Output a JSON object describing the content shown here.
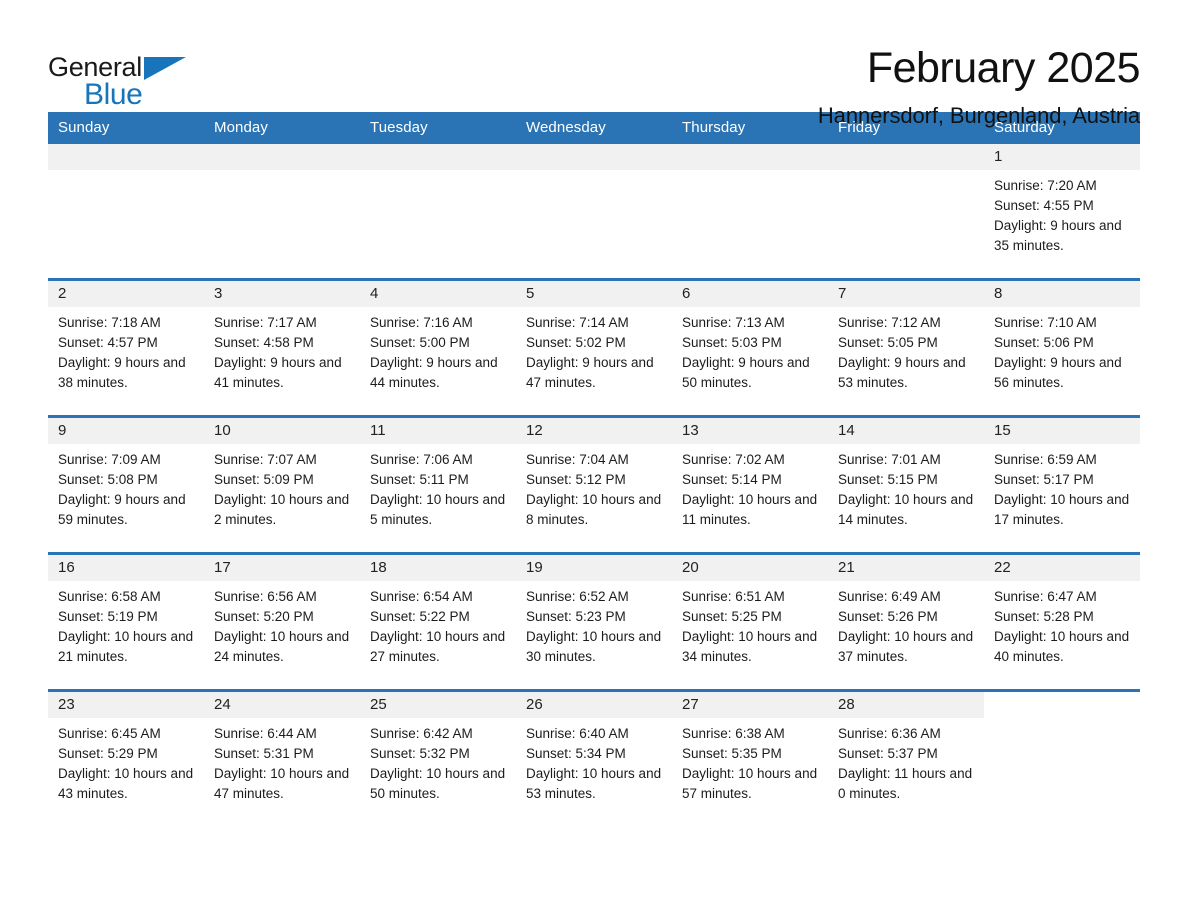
{
  "brand": {
    "name_part1": "General",
    "name_part2": "Blue",
    "triangle_color": "#1874bb"
  },
  "header": {
    "title": "February 2025",
    "subtitle": "Hannersdorf, Burgenland, Austria",
    "accent_color": "#2a74b5"
  },
  "weekday_headers": [
    "Sunday",
    "Monday",
    "Tuesday",
    "Wednesday",
    "Thursday",
    "Friday",
    "Saturday"
  ],
  "weeks": [
    [
      {
        "day": "",
        "sunrise": "",
        "sunset": "",
        "daylight": "",
        "empty": true
      },
      {
        "day": "",
        "sunrise": "",
        "sunset": "",
        "daylight": "",
        "empty": true
      },
      {
        "day": "",
        "sunrise": "",
        "sunset": "",
        "daylight": "",
        "empty": true
      },
      {
        "day": "",
        "sunrise": "",
        "sunset": "",
        "daylight": "",
        "empty": true
      },
      {
        "day": "",
        "sunrise": "",
        "sunset": "",
        "daylight": "",
        "empty": true
      },
      {
        "day": "",
        "sunrise": "",
        "sunset": "",
        "daylight": "",
        "empty": true
      },
      {
        "day": "1",
        "sunrise": "Sunrise: 7:20 AM",
        "sunset": "Sunset: 4:55 PM",
        "daylight": "Daylight: 9 hours and 35 minutes.",
        "empty": false
      }
    ],
    [
      {
        "day": "2",
        "sunrise": "Sunrise: 7:18 AM",
        "sunset": "Sunset: 4:57 PM",
        "daylight": "Daylight: 9 hours and 38 minutes.",
        "empty": false
      },
      {
        "day": "3",
        "sunrise": "Sunrise: 7:17 AM",
        "sunset": "Sunset: 4:58 PM",
        "daylight": "Daylight: 9 hours and 41 minutes.",
        "empty": false
      },
      {
        "day": "4",
        "sunrise": "Sunrise: 7:16 AM",
        "sunset": "Sunset: 5:00 PM",
        "daylight": "Daylight: 9 hours and 44 minutes.",
        "empty": false
      },
      {
        "day": "5",
        "sunrise": "Sunrise: 7:14 AM",
        "sunset": "Sunset: 5:02 PM",
        "daylight": "Daylight: 9 hours and 47 minutes.",
        "empty": false
      },
      {
        "day": "6",
        "sunrise": "Sunrise: 7:13 AM",
        "sunset": "Sunset: 5:03 PM",
        "daylight": "Daylight: 9 hours and 50 minutes.",
        "empty": false
      },
      {
        "day": "7",
        "sunrise": "Sunrise: 7:12 AM",
        "sunset": "Sunset: 5:05 PM",
        "daylight": "Daylight: 9 hours and 53 minutes.",
        "empty": false
      },
      {
        "day": "8",
        "sunrise": "Sunrise: 7:10 AM",
        "sunset": "Sunset: 5:06 PM",
        "daylight": "Daylight: 9 hours and 56 minutes.",
        "empty": false
      }
    ],
    [
      {
        "day": "9",
        "sunrise": "Sunrise: 7:09 AM",
        "sunset": "Sunset: 5:08 PM",
        "daylight": "Daylight: 9 hours and 59 minutes.",
        "empty": false
      },
      {
        "day": "10",
        "sunrise": "Sunrise: 7:07 AM",
        "sunset": "Sunset: 5:09 PM",
        "daylight": "Daylight: 10 hours and 2 minutes.",
        "empty": false
      },
      {
        "day": "11",
        "sunrise": "Sunrise: 7:06 AM",
        "sunset": "Sunset: 5:11 PM",
        "daylight": "Daylight: 10 hours and 5 minutes.",
        "empty": false
      },
      {
        "day": "12",
        "sunrise": "Sunrise: 7:04 AM",
        "sunset": "Sunset: 5:12 PM",
        "daylight": "Daylight: 10 hours and 8 minutes.",
        "empty": false
      },
      {
        "day": "13",
        "sunrise": "Sunrise: 7:02 AM",
        "sunset": "Sunset: 5:14 PM",
        "daylight": "Daylight: 10 hours and 11 minutes.",
        "empty": false
      },
      {
        "day": "14",
        "sunrise": "Sunrise: 7:01 AM",
        "sunset": "Sunset: 5:15 PM",
        "daylight": "Daylight: 10 hours and 14 minutes.",
        "empty": false
      },
      {
        "day": "15",
        "sunrise": "Sunrise: 6:59 AM",
        "sunset": "Sunset: 5:17 PM",
        "daylight": "Daylight: 10 hours and 17 minutes.",
        "empty": false
      }
    ],
    [
      {
        "day": "16",
        "sunrise": "Sunrise: 6:58 AM",
        "sunset": "Sunset: 5:19 PM",
        "daylight": "Daylight: 10 hours and 21 minutes.",
        "empty": false
      },
      {
        "day": "17",
        "sunrise": "Sunrise: 6:56 AM",
        "sunset": "Sunset: 5:20 PM",
        "daylight": "Daylight: 10 hours and 24 minutes.",
        "empty": false
      },
      {
        "day": "18",
        "sunrise": "Sunrise: 6:54 AM",
        "sunset": "Sunset: 5:22 PM",
        "daylight": "Daylight: 10 hours and 27 minutes.",
        "empty": false
      },
      {
        "day": "19",
        "sunrise": "Sunrise: 6:52 AM",
        "sunset": "Sunset: 5:23 PM",
        "daylight": "Daylight: 10 hours and 30 minutes.",
        "empty": false
      },
      {
        "day": "20",
        "sunrise": "Sunrise: 6:51 AM",
        "sunset": "Sunset: 5:25 PM",
        "daylight": "Daylight: 10 hours and 34 minutes.",
        "empty": false
      },
      {
        "day": "21",
        "sunrise": "Sunrise: 6:49 AM",
        "sunset": "Sunset: 5:26 PM",
        "daylight": "Daylight: 10 hours and 37 minutes.",
        "empty": false
      },
      {
        "day": "22",
        "sunrise": "Sunrise: 6:47 AM",
        "sunset": "Sunset: 5:28 PM",
        "daylight": "Daylight: 10 hours and 40 minutes.",
        "empty": false
      }
    ],
    [
      {
        "day": "23",
        "sunrise": "Sunrise: 6:45 AM",
        "sunset": "Sunset: 5:29 PM",
        "daylight": "Daylight: 10 hours and 43 minutes.",
        "empty": false
      },
      {
        "day": "24",
        "sunrise": "Sunrise: 6:44 AM",
        "sunset": "Sunset: 5:31 PM",
        "daylight": "Daylight: 10 hours and 47 minutes.",
        "empty": false
      },
      {
        "day": "25",
        "sunrise": "Sunrise: 6:42 AM",
        "sunset": "Sunset: 5:32 PM",
        "daylight": "Daylight: 10 hours and 50 minutes.",
        "empty": false
      },
      {
        "day": "26",
        "sunrise": "Sunrise: 6:40 AM",
        "sunset": "Sunset: 5:34 PM",
        "daylight": "Daylight: 10 hours and 53 minutes.",
        "empty": false
      },
      {
        "day": "27",
        "sunrise": "Sunrise: 6:38 AM",
        "sunset": "Sunset: 5:35 PM",
        "daylight": "Daylight: 10 hours and 57 minutes.",
        "empty": false
      },
      {
        "day": "28",
        "sunrise": "Sunrise: 6:36 AM",
        "sunset": "Sunset: 5:37 PM",
        "daylight": "Daylight: 11 hours and 0 minutes.",
        "empty": false
      },
      {
        "day": "",
        "sunrise": "",
        "sunset": "",
        "daylight": "",
        "empty": true
      }
    ]
  ]
}
